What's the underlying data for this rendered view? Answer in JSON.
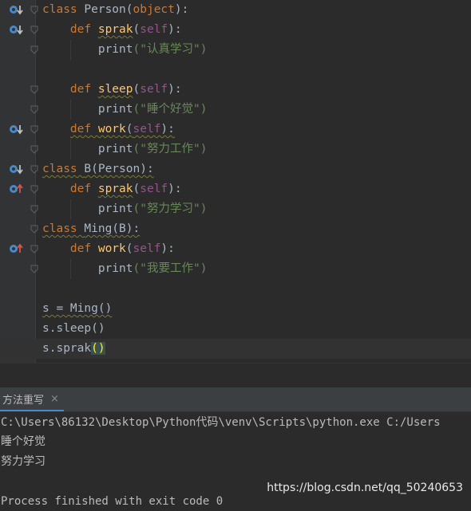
{
  "editor": {
    "lines": [
      {
        "indent": "",
        "parts": [
          {
            "t": "class ",
            "c": "kw"
          },
          {
            "t": "Person(",
            "c": ""
          },
          {
            "t": "object",
            "c": "kw"
          },
          {
            "t": "):",
            "c": ""
          }
        ],
        "marker": "override"
      },
      {
        "indent": "    ",
        "parts": [
          {
            "t": "def ",
            "c": "kw"
          },
          {
            "t": "sprak",
            "c": "fn wavy"
          },
          {
            "t": "(",
            "c": ""
          },
          {
            "t": "self",
            "c": "self"
          },
          {
            "t": "):",
            "c": ""
          }
        ],
        "marker": "override"
      },
      {
        "indent": "        ",
        "parts": [
          {
            "t": "print",
            "c": ""
          },
          {
            "t": "(\"认真学习\")",
            "c": "str"
          }
        ],
        "marker": ""
      },
      {
        "indent": "",
        "parts": [],
        "marker": ""
      },
      {
        "indent": "    ",
        "parts": [
          {
            "t": "def ",
            "c": "kw"
          },
          {
            "t": "sleep",
            "c": "fn wavy"
          },
          {
            "t": "(",
            "c": ""
          },
          {
            "t": "self",
            "c": "self"
          },
          {
            "t": "):",
            "c": ""
          }
        ],
        "marker": ""
      },
      {
        "indent": "        ",
        "parts": [
          {
            "t": "print",
            "c": ""
          },
          {
            "t": "(\"睡个好觉\")",
            "c": "str"
          }
        ],
        "marker": ""
      },
      {
        "indent": "    ",
        "parts": [
          {
            "t": "def ",
            "c": "kw wavy"
          },
          {
            "t": "work",
            "c": "fn wavy"
          },
          {
            "t": "(",
            "c": "wavy"
          },
          {
            "t": "self",
            "c": "self wavy"
          },
          {
            "t": "):",
            "c": "wavy"
          }
        ],
        "marker": "override"
      },
      {
        "indent": "        ",
        "parts": [
          {
            "t": "print",
            "c": ""
          },
          {
            "t": "(\"努力工作\")",
            "c": "str"
          }
        ],
        "marker": ""
      },
      {
        "indent": "",
        "parts": [
          {
            "t": "class ",
            "c": "kw wavy"
          },
          {
            "t": "B(Person):",
            "c": "wavy"
          }
        ],
        "marker": "override"
      },
      {
        "indent": "    ",
        "parts": [
          {
            "t": "def ",
            "c": "kw"
          },
          {
            "t": "sprak",
            "c": "fn wavy"
          },
          {
            "t": "(",
            "c": ""
          },
          {
            "t": "self",
            "c": "self"
          },
          {
            "t": "):",
            "c": ""
          }
        ],
        "marker": "overrides"
      },
      {
        "indent": "        ",
        "parts": [
          {
            "t": "print",
            "c": ""
          },
          {
            "t": "(\"努力学习\")",
            "c": "str"
          }
        ],
        "marker": ""
      },
      {
        "indent": "",
        "parts": [
          {
            "t": "class ",
            "c": "kw wavy"
          },
          {
            "t": "Ming(B):",
            "c": "wavy"
          }
        ],
        "marker": ""
      },
      {
        "indent": "    ",
        "parts": [
          {
            "t": "def ",
            "c": "kw"
          },
          {
            "t": "work",
            "c": "fn"
          },
          {
            "t": "(",
            "c": ""
          },
          {
            "t": "self",
            "c": "self"
          },
          {
            "t": "):",
            "c": ""
          }
        ],
        "marker": "overrides"
      },
      {
        "indent": "        ",
        "parts": [
          {
            "t": "print",
            "c": ""
          },
          {
            "t": "(\"我要工作\")",
            "c": "str"
          }
        ],
        "marker": ""
      },
      {
        "indent": "",
        "parts": [],
        "marker": ""
      },
      {
        "indent": "",
        "parts": [
          {
            "t": "s = Ming()",
            "c": "wavy"
          }
        ],
        "marker": ""
      },
      {
        "indent": "",
        "parts": [
          {
            "t": "s.sleep()",
            "c": ""
          }
        ],
        "marker": ""
      },
      {
        "indent": "",
        "parts": [
          {
            "t": "s.sprak",
            "c": ""
          },
          {
            "t": "()",
            "c": "brace-hl"
          }
        ],
        "marker": ""
      }
    ],
    "current_line": 17
  },
  "run_panel": {
    "tab_label": "方法重写",
    "tab_close": "×",
    "output": [
      "C:\\Users\\86132\\Desktop\\Python代码\\venv\\Scripts\\python.exe C:/Users",
      "睡个好觉",
      "努力学习",
      "",
      "Process finished with exit code 0"
    ]
  },
  "watermark": "https://blog.csdn.net/qq_50240653",
  "colors": {
    "background": "#2b2b2b",
    "keyword": "#cc7832",
    "self": "#94558d",
    "function": "#ffc66d",
    "string": "#6a8759",
    "override_marker": "#4a88c7",
    "overrides_marker_arrow": "#d9534f"
  }
}
